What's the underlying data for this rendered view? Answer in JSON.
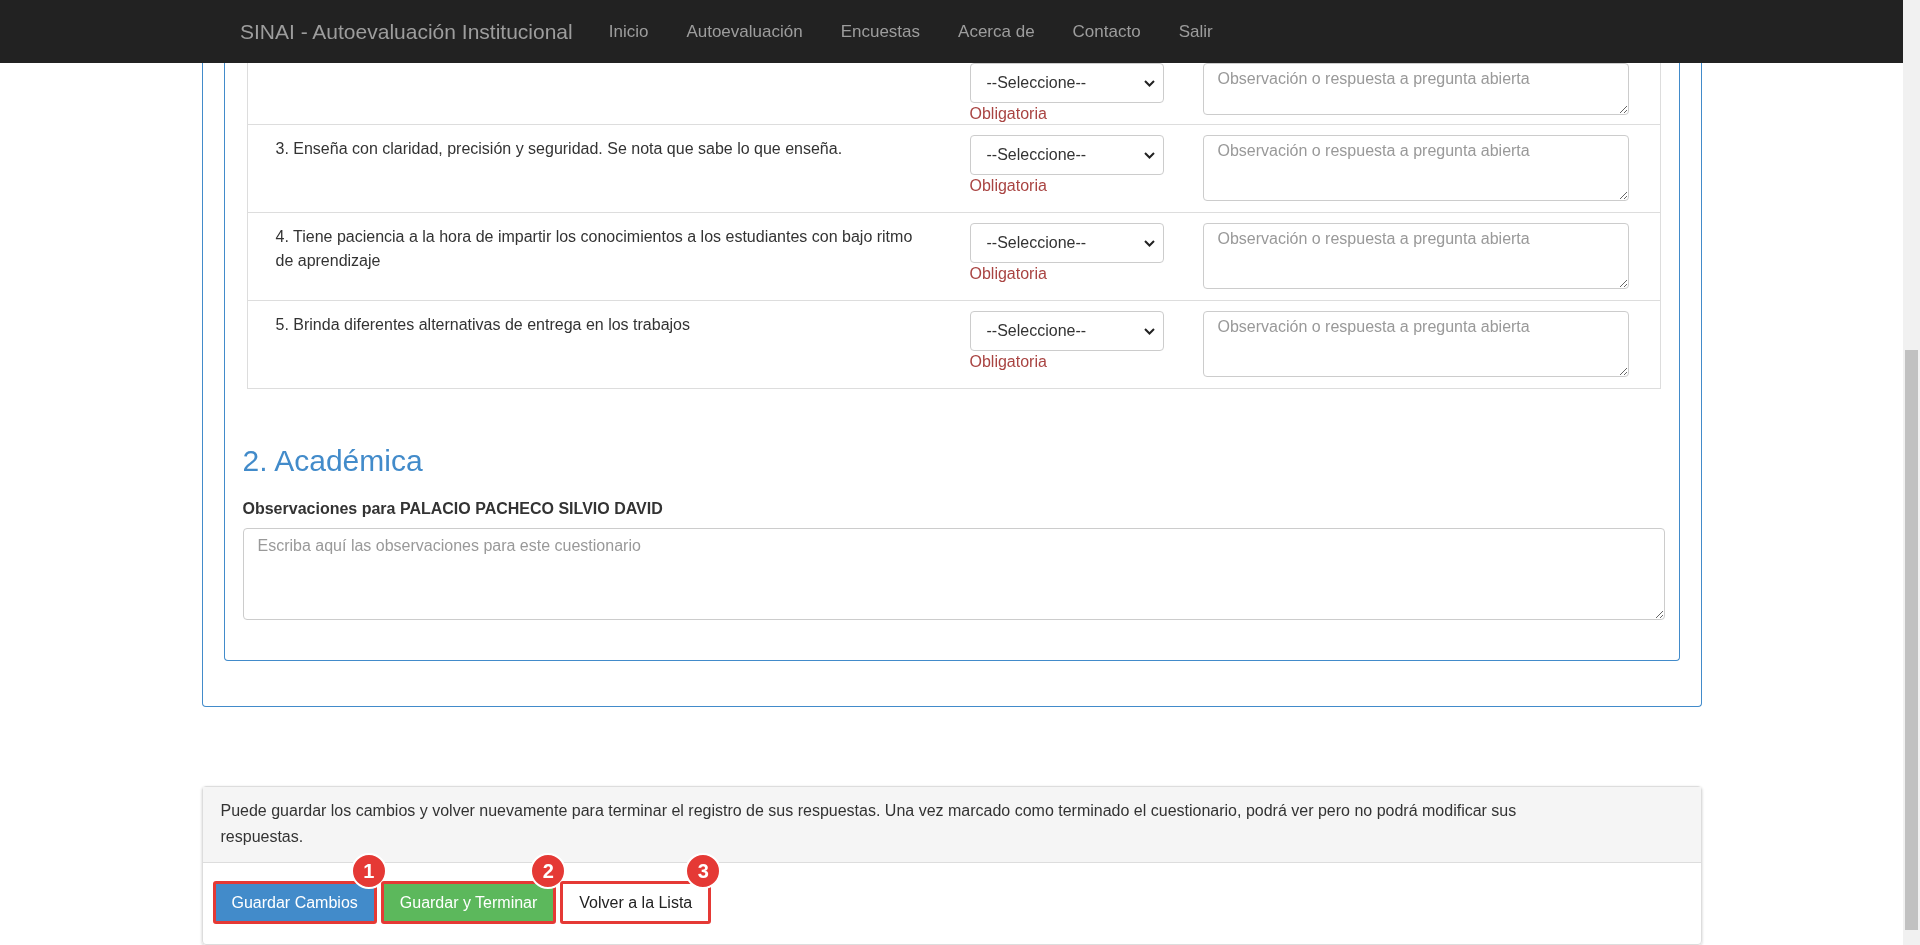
{
  "navbar": {
    "brand": "SINAI - Autoevaluación Institucional",
    "items": [
      "Inicio",
      "Autoevaluación",
      "Encuestas",
      "Acerca de",
      "Contacto",
      "Salir"
    ]
  },
  "questions": [
    {
      "select": "--Seleccione--",
      "required": "Obligatoria",
      "placeholder": "Observación o respuesta a pregunta abierta"
    },
    {
      "text": "3. Enseña con claridad, precisión y seguridad. Se nota que sabe lo que enseña.",
      "select": "--Seleccione--",
      "required": "Obligatoria",
      "placeholder": "Observación o respuesta a pregunta abierta"
    },
    {
      "text": "4. Tiene paciencia a la hora de impartir los conocimientos a los estudiantes con bajo ritmo de aprendizaje",
      "select": "--Seleccione--",
      "required": "Obligatoria",
      "placeholder": "Observación o respuesta a pregunta abierta"
    },
    {
      "text": "5. Brinda diferentes alternativas de entrega en los trabajos",
      "select": "--Seleccione--",
      "required": "Obligatoria",
      "placeholder": "Observación o respuesta a pregunta abierta"
    }
  ],
  "section": {
    "number": "2.",
    "title": "Académica",
    "label": "Observaciones para PALACIO PACHECO SILVIO DAVID",
    "placeholder": "Escriba aquí las observaciones para este cuestionario"
  },
  "footer": {
    "notice": "Puede guardar los cambios y volver nuevamente para terminar el registro de sus respuestas. Una vez marcado como terminado el cuestionario, podrá ver pero no podrá modificar sus respuestas.",
    "buttons": [
      {
        "label": "Guardar Cambios",
        "kind": "primary",
        "marker": "1"
      },
      {
        "label": "Guardar y Terminar",
        "kind": "success",
        "marker": "2"
      },
      {
        "label": "Volver a la Lista",
        "kind": "default",
        "marker": "3"
      }
    ]
  }
}
